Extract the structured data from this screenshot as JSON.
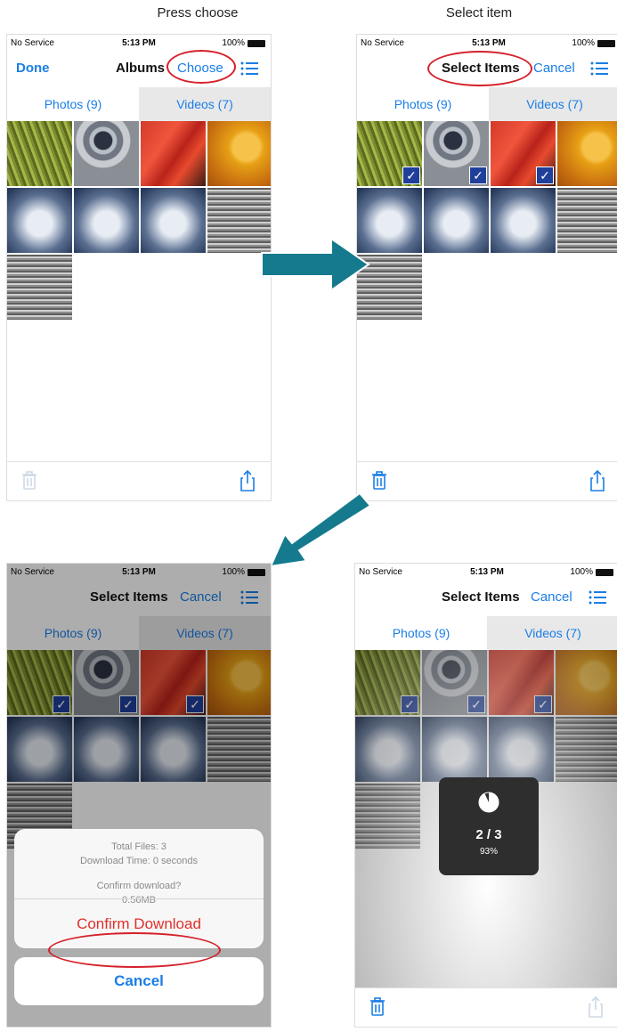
{
  "captions": {
    "step1": "Press choose",
    "step2": "Select item"
  },
  "status": {
    "carrier": "No Service",
    "time": "5:13 PM",
    "battery": "100%"
  },
  "screen1": {
    "done": "Done",
    "title": "Albums",
    "choose": "Choose"
  },
  "screens": {
    "select_title": "Select Items",
    "cancel": "Cancel"
  },
  "tabs": {
    "photos": "Photos (9)",
    "videos": "Videos (7)"
  },
  "icons": [
    "list-icon",
    "trash-icon",
    "share-icon",
    "check-icon",
    "arrow-right-icon",
    "arrow-down-left-icon",
    "pie-progress-icon"
  ],
  "dialog": {
    "total_files": "Total Files: 3",
    "download_time": "Download Time: 0 seconds",
    "confirm_question": "Confirm download?",
    "size": "0.56MB",
    "confirm_button": "Confirm Download",
    "cancel_button": "Cancel"
  },
  "progress": {
    "count": "2 / 3",
    "percent": "93%",
    "fraction": 0.93
  },
  "colors": {
    "accent": "#1a7ee6",
    "highlight": "#d6202a",
    "arrow": "#157a8e",
    "check_bg": "#1f3f9a"
  }
}
